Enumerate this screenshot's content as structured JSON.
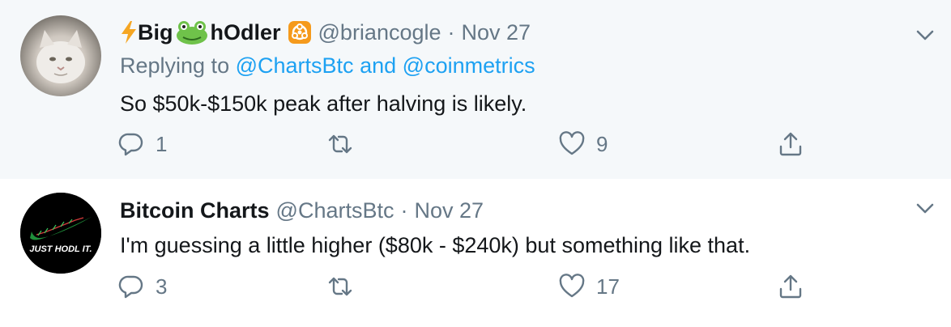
{
  "tweets": [
    {
      "display_name_part1": "Big",
      "display_name_part2": "hOdler",
      "handle": "@briancogle",
      "separator": "·",
      "date": "Nov 27",
      "replying_prefix": "Replying to",
      "replying_user1": "@ChartsBtc",
      "replying_and": "and",
      "replying_user2": "@coinmetrics",
      "text": "So $50k-$150k peak after halving is likely.",
      "reply_count": "1",
      "retweet_count": "",
      "like_count": "9"
    },
    {
      "display_name": "Bitcoin Charts",
      "handle": "@ChartsBtc",
      "separator": "·",
      "date": "Nov 27",
      "avatar_text": "JUST HODL IT.",
      "text": "I'm guessing a little higher ($80k - $240k) but something like that.",
      "reply_count": "3",
      "retweet_count": "",
      "like_count": "17"
    }
  ],
  "icons": {
    "reply": "reply-icon",
    "retweet": "retweet-icon",
    "like": "heart-icon",
    "share": "share-icon",
    "more": "chevron-down-icon"
  },
  "colors": {
    "link": "#1da1f2",
    "secondary_text": "#657786",
    "highlight_bg": "#f5f8fa",
    "thread_line": "#ccd6dd"
  }
}
